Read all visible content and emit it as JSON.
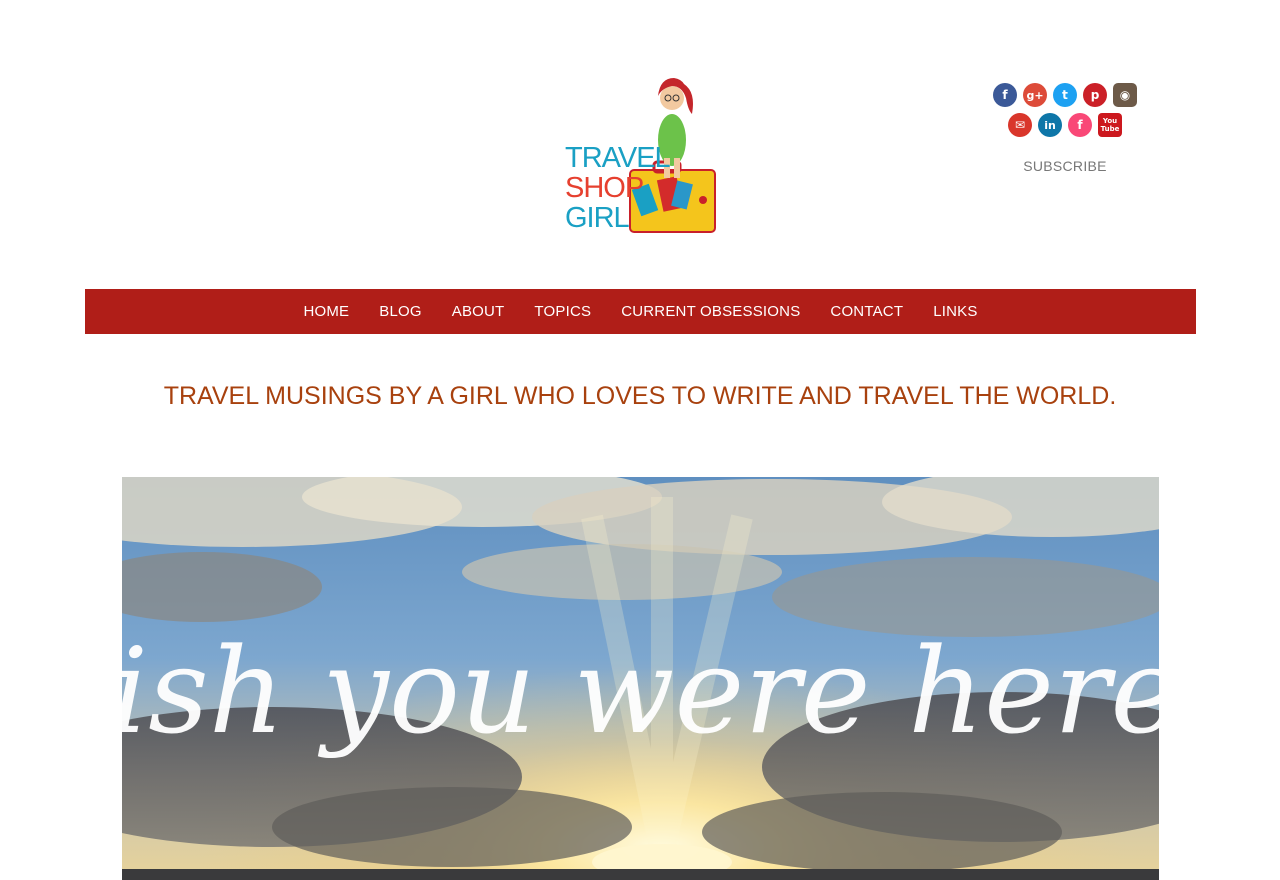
{
  "logo": {
    "line1": "TRAVEL",
    "line2": "SHOP",
    "line3": "GIRL"
  },
  "social": {
    "row1": [
      {
        "icon": "facebook-icon",
        "glyph": "f",
        "color": "#3b5998"
      },
      {
        "icon": "google-plus-icon",
        "glyph": "g+",
        "color": "#dd4b39"
      },
      {
        "icon": "twitter-icon",
        "glyph": "t",
        "color": "#1da1f2"
      },
      {
        "icon": "pinterest-icon",
        "glyph": "p",
        "color": "#cb2027"
      },
      {
        "icon": "instagram-icon",
        "glyph": "◉",
        "color": "#6d5a48"
      }
    ],
    "row2": [
      {
        "icon": "email-icon",
        "glyph": "✉",
        "color": "#d9362b"
      },
      {
        "icon": "linkedin-icon",
        "glyph": "in",
        "color": "#0e76a8"
      },
      {
        "icon": "foursquare-icon",
        "glyph": "f",
        "color": "#f94877"
      },
      {
        "icon": "youtube-icon",
        "glyph": "You Tube",
        "color": "#cc181e"
      }
    ],
    "subscribe_label": "SUBSCRIBE"
  },
  "nav": {
    "items": [
      "HOME",
      "BLOG",
      "ABOUT",
      "TOPICS",
      "CURRENT OBSESSIONS",
      "CONTACT",
      "LINKS"
    ],
    "bg_color": "#b01e18"
  },
  "tagline": "TRAVEL MUSINGS BY A GIRL WHO LOVES TO WRITE AND TRAVEL THE WORLD.",
  "hero": {
    "script_text": "Wish you were here..."
  }
}
